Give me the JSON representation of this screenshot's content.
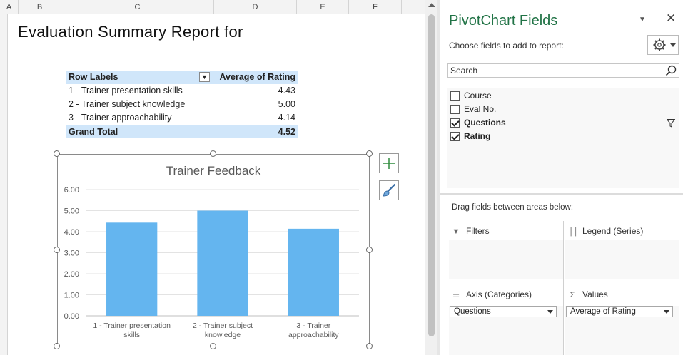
{
  "sheet": {
    "columns": [
      "A",
      "B",
      "C",
      "D",
      "E",
      "F"
    ],
    "title": "Evaluation Summary Report for"
  },
  "pivot": {
    "header": {
      "label": "Row Labels",
      "value": "Average of Rating"
    },
    "rows": [
      {
        "label": "1 - Trainer presentation skills",
        "value": "4.43"
      },
      {
        "label": "2 - Trainer subject knowledge",
        "value": "5.00"
      },
      {
        "label": "3 - Trainer approachability",
        "value": "4.14"
      }
    ],
    "total": {
      "label": "Grand Total",
      "value": "4.52"
    }
  },
  "chart_data": {
    "type": "bar",
    "title": "Trainer Feedback",
    "categories": [
      [
        "1 - Trainer presentation",
        "skills"
      ],
      [
        "2 - Trainer subject",
        "knowledge"
      ],
      [
        "3 - Trainer",
        "approachability"
      ]
    ],
    "values": [
      4.43,
      5.0,
      4.14
    ],
    "ylim": [
      0,
      6
    ],
    "yticks": [
      "0.00",
      "1.00",
      "2.00",
      "3.00",
      "4.00",
      "5.00",
      "6.00"
    ],
    "bar_color": "#64b5ef",
    "grid": true,
    "xlabel": "",
    "ylabel": ""
  },
  "pane": {
    "title": "PivotChart Fields",
    "choose_label": "Choose fields to add to report:",
    "search_placeholder": "Search",
    "fields": [
      {
        "label": "Course",
        "checked": false,
        "bold": false,
        "filter": false
      },
      {
        "label": "Eval No.",
        "checked": false,
        "bold": false,
        "filter": false
      },
      {
        "label": "Questions",
        "checked": true,
        "bold": true,
        "filter": true
      },
      {
        "label": "Rating",
        "checked": true,
        "bold": true,
        "filter": false
      }
    ],
    "drag_label": "Drag fields between areas below:",
    "areas": {
      "filters": {
        "label": "Filters"
      },
      "legend": {
        "label": "Legend (Series)"
      },
      "axis": {
        "label": "Axis (Categories)",
        "value": "Questions"
      },
      "values": {
        "label": "Values",
        "value": "Average of Rating"
      }
    }
  },
  "colors": {
    "accent": "#217346",
    "pivot_header": "#d0e6fa",
    "bar": "#64b5ef"
  }
}
